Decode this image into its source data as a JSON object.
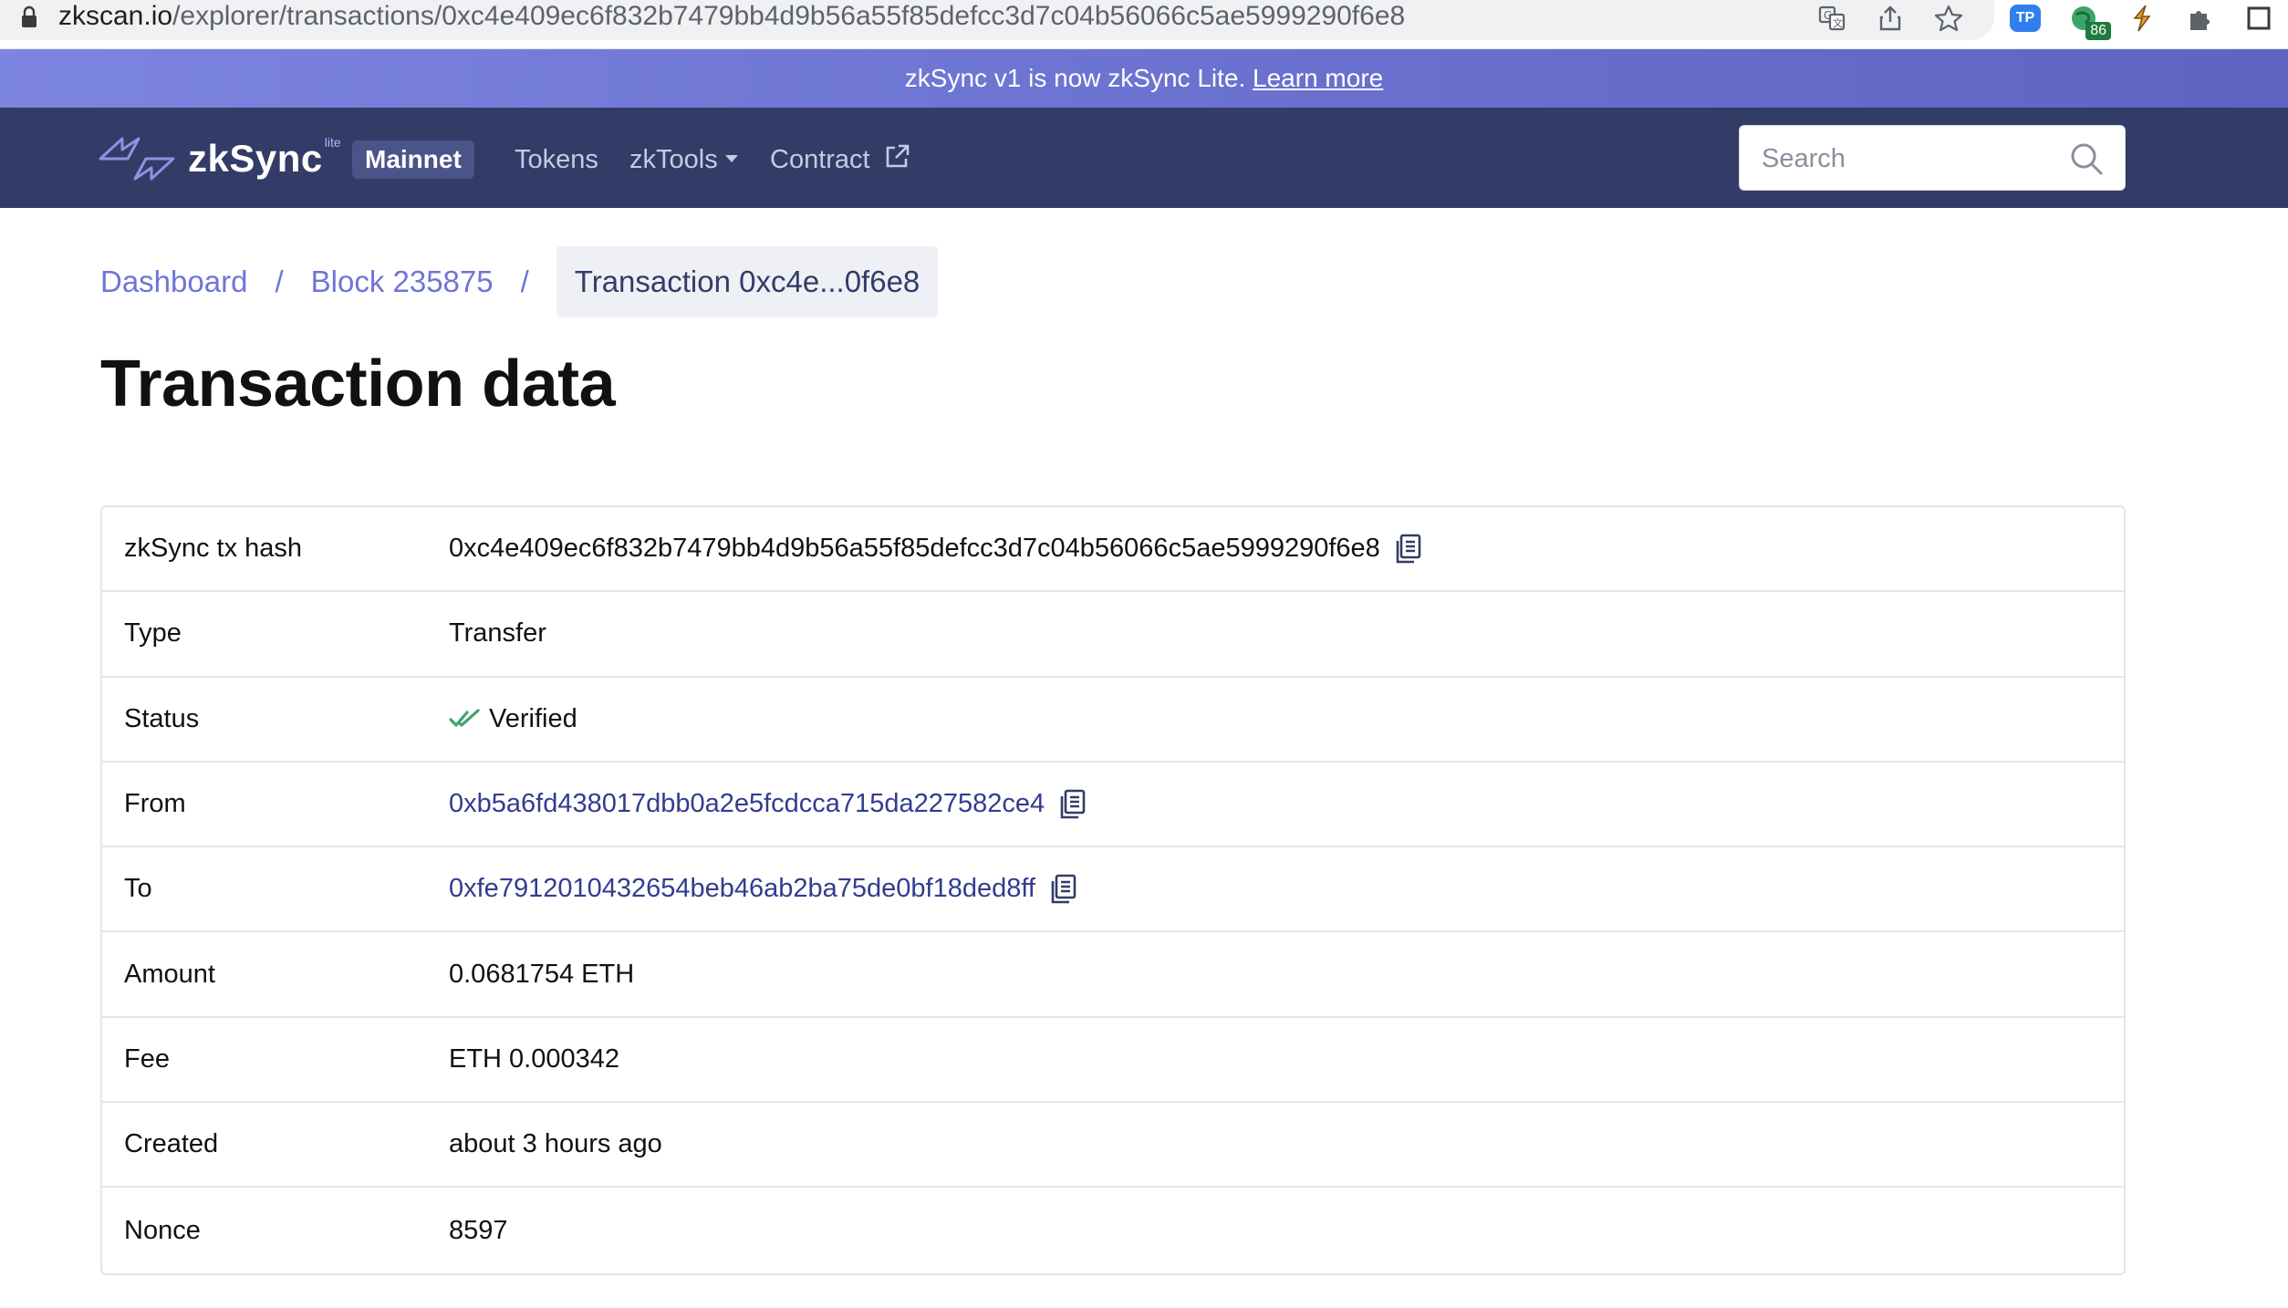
{
  "browser": {
    "url_host": "zkscan.io",
    "url_path": "/explorer/transactions/0xc4e409ec6f832b7479bb4d9b56a55f85defcc3d7c04b56066c5ae5999290f6e8",
    "extension_badge": "86",
    "tp_label": "TP"
  },
  "banner": {
    "text": "zkSync v1 is now zkSync Lite.",
    "link": "Learn more"
  },
  "navbar": {
    "logo_text": "zkSync",
    "logo_sup": "lite",
    "network": "Mainnet",
    "links": {
      "tokens": "Tokens",
      "zktools": "zkTools",
      "contract": "Contract"
    },
    "search_placeholder": "Search"
  },
  "breadcrumb": {
    "dashboard": "Dashboard",
    "block": "Block 235875",
    "current": "Transaction 0xc4e...0f6e8"
  },
  "page_title": "Transaction data",
  "rows": [
    {
      "label": "zkSync tx hash",
      "value": "0xc4e409ec6f832b7479bb4d9b56a55f85defcc3d7c04b56066c5ae5999290f6e8"
    },
    {
      "label": "Type",
      "value": "Transfer"
    },
    {
      "label": "Status",
      "value": "Verified"
    },
    {
      "label": "From",
      "value": "0xb5a6fd438017dbb0a2e5fcdcca715da227582ce4"
    },
    {
      "label": "To",
      "value": "0xfe7912010432654beb46ab2ba75de0bf18ded8ff"
    },
    {
      "label": "Amount",
      "value": "0.0681754 ETH"
    },
    {
      "label": "Fee",
      "value": "ETH 0.000342"
    },
    {
      "label": "Created",
      "value": "about 3 hours ago"
    },
    {
      "label": "Nonce",
      "value": "8597"
    }
  ],
  "colors": {
    "banner": "#6a71cf",
    "navbar": "#323c66",
    "link": "#6e75d8",
    "verified": "#3fa66a"
  },
  "icons": [
    "lock-icon",
    "translate-icon",
    "share-icon",
    "star-icon",
    "puzzle-icon",
    "search-icon",
    "copy-icon",
    "double-check-icon",
    "external-link-icon"
  ]
}
